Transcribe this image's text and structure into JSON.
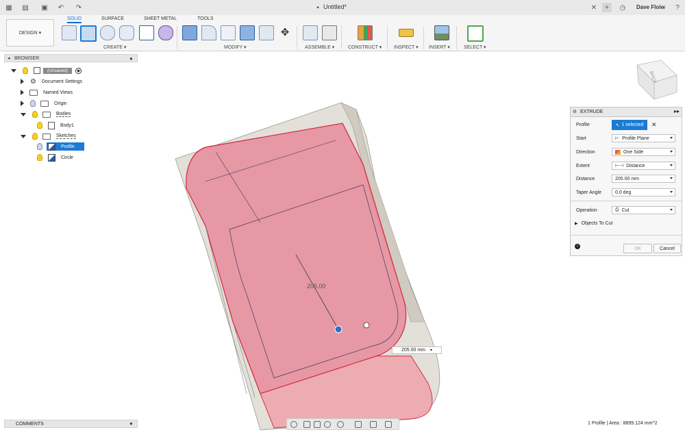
{
  "app": {
    "document_title": "Untitled*",
    "user_name": "Dave Floiw"
  },
  "ribbon": {
    "design_label": "DESIGN",
    "tabs": [
      "SOLID",
      "SURFACE",
      "SHEET METAL",
      "TOOLS"
    ],
    "groups": [
      "CREATE",
      "MODIFY",
      "ASSEMBLE",
      "CONSTRUCT",
      "INSPECT",
      "INSERT",
      "SELECT"
    ]
  },
  "browser": {
    "header": "BROWSER",
    "root": "(Unsaved)",
    "items": [
      "Document Settings",
      "Named Views",
      "Origin",
      "Bodies",
      "Body1",
      "Sketches",
      "Profile",
      "Circle"
    ]
  },
  "comments_label": "COMMENTS",
  "viewcube_label": "BACK",
  "extrude": {
    "title": "EXTRUDE",
    "profile_label": "Profile",
    "profile_value": "1 selected",
    "start_label": "Start",
    "start_value": "Profile Plane",
    "direction_label": "Direction",
    "direction_value": "One Side",
    "extent_label": "Extent",
    "extent_value": "Distance",
    "distance_label": "Distance",
    "distance_value": "205.00 mm",
    "taper_label": "Taper Angle",
    "taper_value": "0.0 deg",
    "operation_label": "Operation",
    "operation_value": "Cut",
    "objects_to_cut": "Objects To Cut",
    "ok": "OK",
    "cancel": "Cancel"
  },
  "viewport": {
    "dimension_text": "205.00",
    "distance_input": "205.00 mm"
  },
  "status": "1 Profile | Area : 8899.124 mm^2",
  "colors": {
    "accent": "#1a7bd4",
    "profile_fill": "#e8889a",
    "body": "#e2e0d8"
  }
}
